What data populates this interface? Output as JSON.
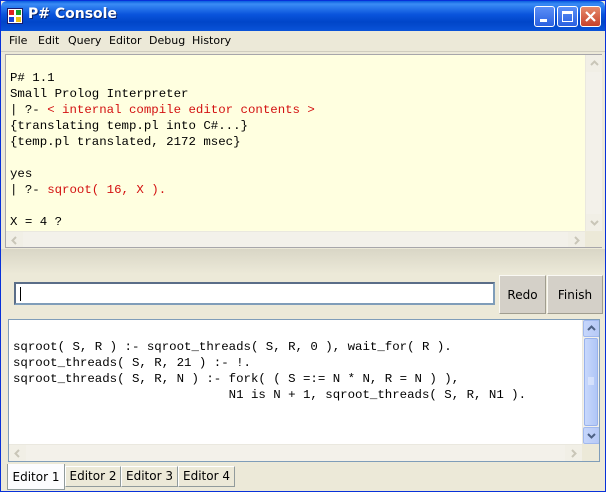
{
  "window": {
    "title": "P# Console"
  },
  "menu": [
    "File",
    "Edit",
    "Query",
    "Editor",
    "Debug",
    "History"
  ],
  "console": {
    "lines": [
      {
        "text": "P# 1.1"
      },
      {
        "text": "Small Prolog Interpreter"
      },
      {
        "prompt": "| ?- ",
        "query": "< internal compile editor contents >"
      },
      {
        "text": "{translating temp.pl into C#...}"
      },
      {
        "text": "{temp.pl translated, 2172 msec}"
      },
      {
        "text": ""
      },
      {
        "text": "yes"
      },
      {
        "prompt": "| ?- ",
        "query": "sqroot( 16, X )."
      },
      {
        "text": ""
      },
      {
        "text": "X = 4 ?"
      }
    ],
    "query_color": "#d31111",
    "background": "#ffffe0"
  },
  "input": {
    "value": "",
    "placeholder": ""
  },
  "buttons": {
    "redo": "Redo",
    "finish": "Finish"
  },
  "editor": {
    "lines": [
      "sqroot( S, R ) :- sqroot_threads( S, R, 0 ), wait_for( R ).",
      "sqroot_threads( S, R, 21 ) :- !.",
      "sqroot_threads( S, R, N ) :- fork( ( S =:= N * N, R = N ) ),",
      "                             N1 is N + 1, sqroot_threads( S, R, N1 )."
    ]
  },
  "tabs": [
    "Editor 1",
    "Editor 2",
    "Editor 3",
    "Editor 4"
  ],
  "active_tab": 0
}
